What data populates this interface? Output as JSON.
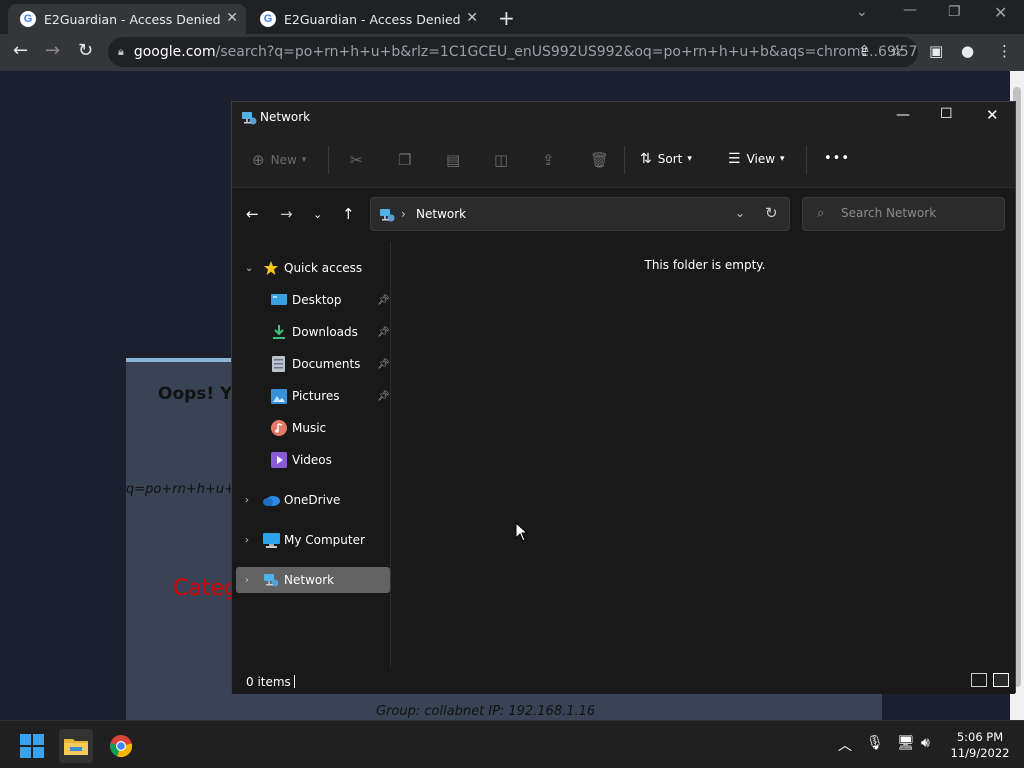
{
  "browser": {
    "tabs": [
      {
        "title": "E2Guardian - Access Denied",
        "favicon": "G"
      },
      {
        "title": "E2Guardian - Access Denied",
        "favicon": "G"
      }
    ],
    "url_host": "google.com",
    "url_path": "/search?q=po+rn+h+u+b&rlz=1C1GCEU_enUS992US992&oq=po+rn+h+u+b&aqs=chrome..69i57...."
  },
  "page": {
    "oops_text": "Oops! Yo",
    "query_text": "q=po+rn+h+u+b",
    "category_text": "Categ",
    "group_text": "Group: collabnet   IP: 192.168.1.16"
  },
  "explorer": {
    "title": "Network",
    "commands": {
      "new": "New",
      "sort": "Sort",
      "view": "View",
      "more": "•••"
    },
    "address": "Network",
    "search_placeholder": "Search Network",
    "nav": {
      "quick_access": "Quick access",
      "desktop": "Desktop",
      "downloads": "Downloads",
      "documents": "Documents",
      "pictures": "Pictures",
      "music": "Music",
      "videos": "Videos",
      "onedrive": "OneDrive",
      "my_computer": "My Computer",
      "network": "Network"
    },
    "empty_message": "This folder is empty.",
    "status_count": "0 items"
  },
  "taskbar": {
    "time": "5:06 PM",
    "date": "11/9/2022"
  },
  "colors": {
    "explorer_bg": "#191919",
    "nav_selected": "#626262",
    "blocked_text": "#dd0000"
  }
}
